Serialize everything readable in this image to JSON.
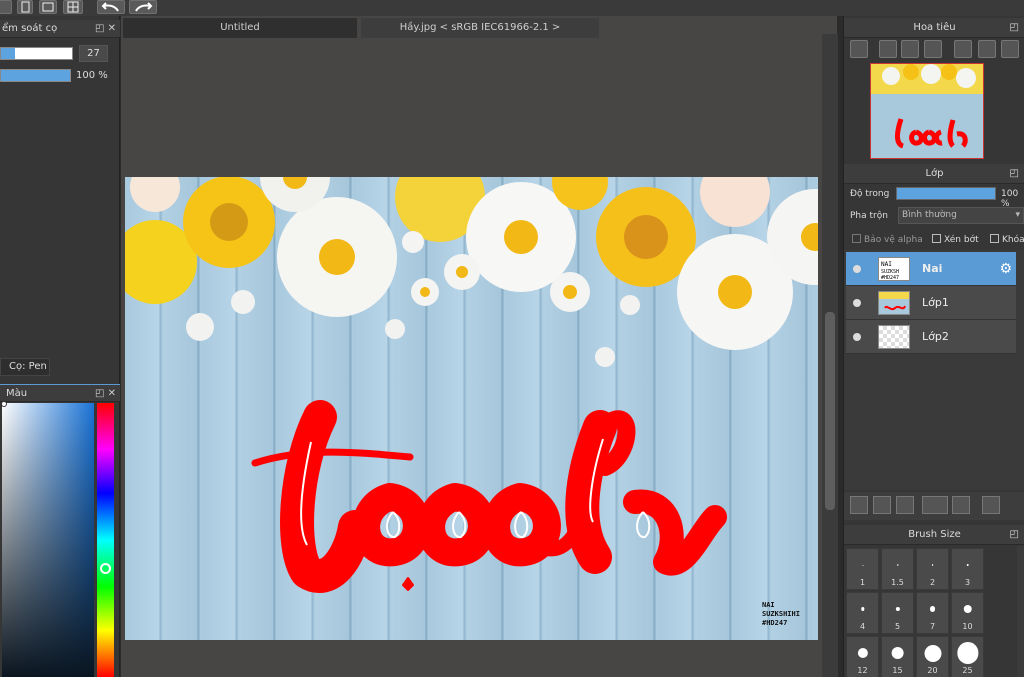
{
  "toolbar": {
    "undo_label": "Undo",
    "redo_label": "Redo"
  },
  "left": {
    "brush_panel_title": "ểm soát cọ",
    "size_value": "27",
    "size_fraction": 0.2,
    "opacity_value": "100 %",
    "opacity_fraction": 1.0,
    "brush_tab": "Cọ: Pen",
    "color_panel_title": "Màu",
    "hue_fraction": 0.6
  },
  "tabs": [
    {
      "label": "Untitled"
    },
    {
      "label": "Hầy.jpg < sRGB IEC61966-2.1 >"
    }
  ],
  "artwork": {
    "lettering": "tooch",
    "signature": "NAI SUZKSHIHI #HD247"
  },
  "navigator": {
    "title": "Hoa tiêu"
  },
  "layers": {
    "title": "Lớp",
    "opacity_label": "Độ trong",
    "opacity_value": "100 %",
    "opacity_fraction": 1.0,
    "blend_label": "Pha trộn",
    "blend_value": "Bình thường",
    "protect_alpha": "Bảo vệ alpha",
    "clip": "Xén bớt",
    "lock": "Khóa",
    "items": [
      {
        "name": "Nai",
        "selected": true
      },
      {
        "name": "Lớp1",
        "selected": false
      },
      {
        "name": "Lớp2",
        "selected": false
      }
    ]
  },
  "brush_size": {
    "title": "Brush Size",
    "sizes": [
      "1",
      "1.5",
      "2",
      "3",
      "4",
      "5",
      "7",
      "10",
      "12",
      "15",
      "20",
      "25"
    ]
  },
  "colors": {
    "accent": "#5b9bd5",
    "lettering": "#ff0000"
  }
}
